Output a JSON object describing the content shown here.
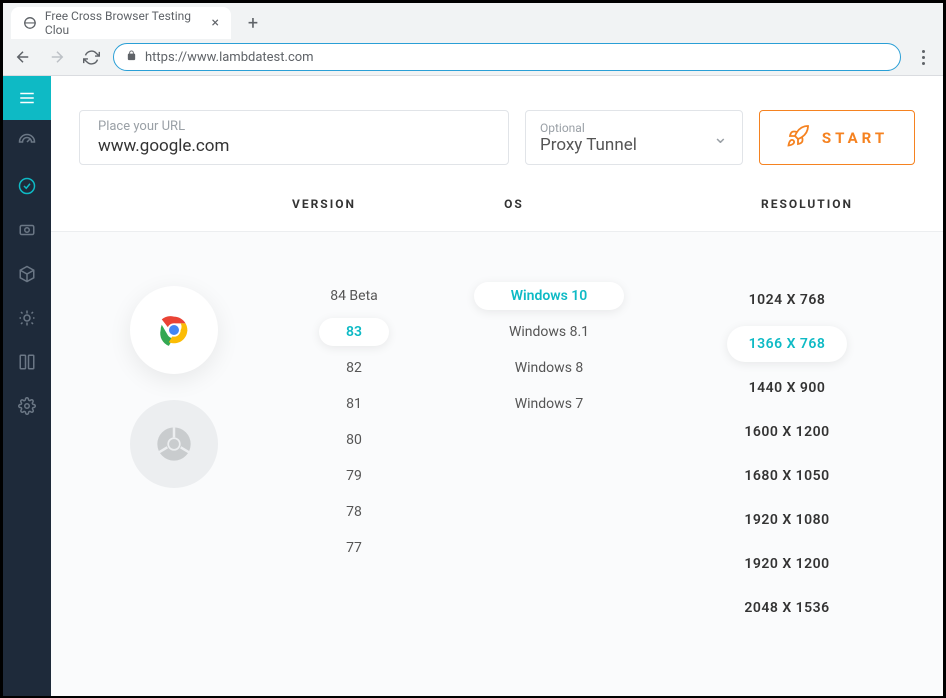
{
  "browser": {
    "tab_title": "Free Cross Browser Testing Clou",
    "url": "https://www.lambdatest.com"
  },
  "sidebar": {
    "items": [
      {
        "name": "menu-icon"
      },
      {
        "name": "gauge-icon"
      },
      {
        "name": "realtime-icon",
        "active": true
      },
      {
        "name": "eye-icon"
      },
      {
        "name": "cube-icon"
      },
      {
        "name": "bug-icon"
      },
      {
        "name": "integrations-icon"
      },
      {
        "name": "gear-icon"
      }
    ]
  },
  "form": {
    "url_placeholder": "Place your URL",
    "url_value": "www.google.com",
    "proxy_label": "Optional",
    "proxy_value": "Proxy Tunnel",
    "start_label": "START"
  },
  "headers": {
    "version": "VERSION",
    "os": "OS",
    "resolution": "RESOLUTION"
  },
  "versions": [
    {
      "label": "84 Beta",
      "selected": false
    },
    {
      "label": "83",
      "selected": true
    },
    {
      "label": "82",
      "selected": false
    },
    {
      "label": "81",
      "selected": false
    },
    {
      "label": "80",
      "selected": false
    },
    {
      "label": "79",
      "selected": false
    },
    {
      "label": "78",
      "selected": false
    },
    {
      "label": "77",
      "selected": false
    }
  ],
  "os_list": [
    {
      "label": "Windows 10",
      "selected": true
    },
    {
      "label": "Windows 8.1",
      "selected": false
    },
    {
      "label": "Windows 8",
      "selected": false
    },
    {
      "label": "Windows 7",
      "selected": false
    }
  ],
  "resolutions": [
    {
      "label": "1024 X 768",
      "selected": false
    },
    {
      "label": "1366 X 768",
      "selected": true
    },
    {
      "label": "1440 X 900",
      "selected": false
    },
    {
      "label": "1600 X 1200",
      "selected": false
    },
    {
      "label": "1680 X 1050",
      "selected": false
    },
    {
      "label": "1920 X 1080",
      "selected": false
    },
    {
      "label": "1920 X 1200",
      "selected": false
    },
    {
      "label": "2048 X 1536",
      "selected": false
    }
  ]
}
